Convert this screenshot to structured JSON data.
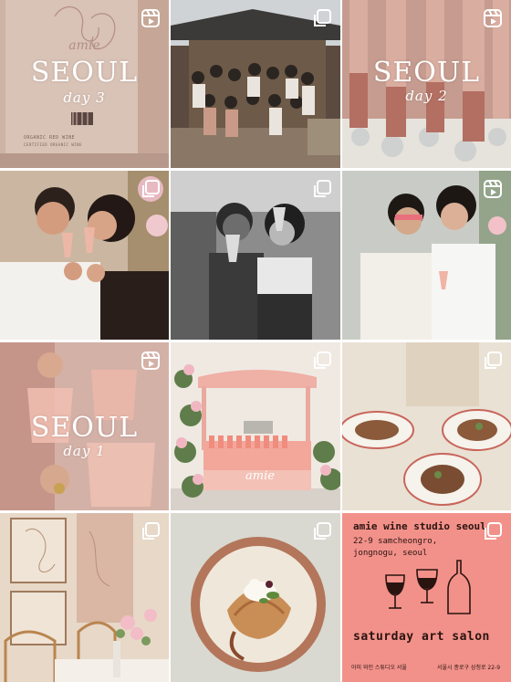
{
  "colors": {
    "poster_pink": "#f2918a",
    "blush": "#e8c8bf",
    "cream": "#efe6dc",
    "ink": "#2a1410"
  },
  "grid": {
    "tiles": [
      {
        "type": "reel",
        "overlay_title": "SEOUL",
        "overlay_sub": "day 3",
        "box_text": "amie",
        "box_caption": "ORGANIC RED WINE",
        "box_meta": "CERTIFIED ORGANIC WINE",
        "icon": "reel-icon"
      },
      {
        "type": "multi",
        "scene": "group photo in courtyard",
        "icon": "carousel-icon"
      },
      {
        "type": "reel",
        "overlay_title": "SEOUL",
        "overlay_sub": "day 2",
        "scene": "rosé bottles on ice",
        "icon": "reel-icon"
      },
      {
        "type": "multi",
        "scene": "couple toasting with rosé",
        "icon": "carousel-icon"
      },
      {
        "type": "multi",
        "scene": "black and white toast",
        "icon": "carousel-icon"
      },
      {
        "type": "reel",
        "scene": "friends with rosé glasses",
        "icon": "reel-icon"
      },
      {
        "type": "reel",
        "overlay_title": "SEOUL",
        "overlay_sub": "day 1",
        "scene": "hands holding rosé glasses",
        "icon": "reel-icon"
      },
      {
        "type": "multi",
        "scene": "pink pop-up bar with flowers",
        "bar_label": "amie",
        "icon": "carousel-icon"
      },
      {
        "type": "multi",
        "scene": "plated dishes served",
        "icon": "carousel-icon"
      },
      {
        "type": "multi",
        "scene": "dining room with art",
        "icon": "carousel-icon"
      },
      {
        "type": "multi",
        "scene": "crêpe dessert plate",
        "icon": "carousel-icon"
      },
      {
        "type": "multi",
        "scene": "event poster",
        "icon": "carousel-icon",
        "poster": {
          "title": "amie wine studio seoul",
          "addr1": "22-9 samcheongro,",
          "addr2": "jongnogu, seoul",
          "event": "saturday art salon",
          "korean_left": "아미 와인 스튜디오 서울",
          "korean_right": "서울시 종로구 삼청로 22-9"
        }
      }
    ]
  }
}
